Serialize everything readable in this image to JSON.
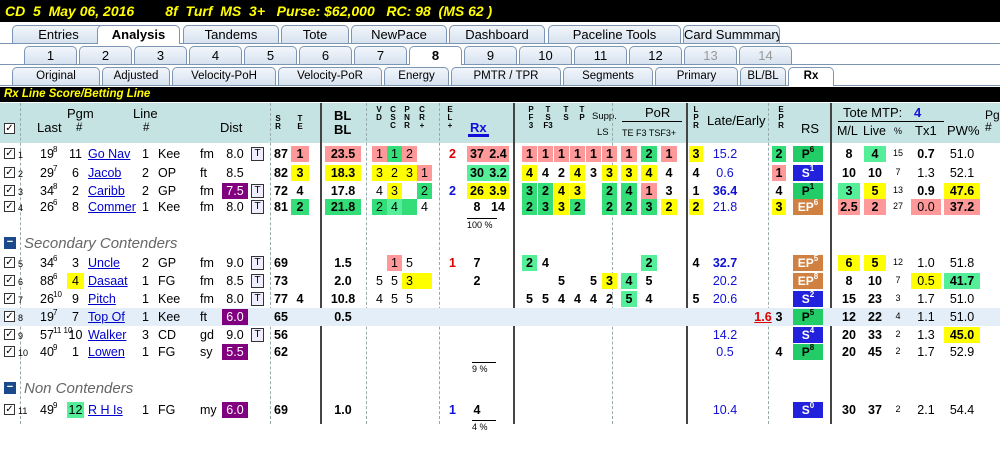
{
  "title": "CD  5  May 06, 2016        8f  Turf  MS  3+   Purse: $62,000   RC: 98  (MS 62 )",
  "tabs1": [
    "Entries",
    "Analysis",
    "Tandems",
    "Tote",
    "NewPace",
    "Dashboard",
    "Paceline Tools",
    "Card Summmary"
  ],
  "tabs2": [
    "1",
    "2",
    "3",
    "4",
    "5",
    "6",
    "7",
    "8",
    "9",
    "10",
    "11",
    "12",
    "13",
    "14"
  ],
  "tabs3": [
    "Original",
    "Adjusted",
    "Velocity-PoH",
    "Velocity-PoR",
    "Energy",
    "PMTR / TPR",
    "Segments",
    "Primary",
    "BL/BL",
    "Rx"
  ],
  "section": "Rx Line Score/Betting Line",
  "hdr": {
    "last": "Last",
    "pgm": "Pgm",
    "pgmh": "#",
    "line": "Line",
    "lineh": "#",
    "dist": "Dist",
    "sr": "S\nR",
    "te": "T\nE",
    "bl": "BL\nBL",
    "vdc": "V\nD",
    "csc": "C\nS\nC",
    "pnr": "P\nN\nR",
    "cr": "C\nR\n+",
    "el": "E\nL\n+",
    "rx": "Rx",
    "pf": "P\nF\n3",
    "tsf": "T\nS\nF3",
    "ts": "T\nS",
    "tp": "T\nP",
    "supp": "Supp.",
    "ls": "LS",
    "por": "PoR",
    "te2": "TE F3 TSF3+",
    "lpr": "L\nP\nR",
    "late": "Late/Early",
    "epr": "E\nP\nR",
    "rs": "RS",
    "tote": "Tote MTP:",
    "mtp": "4",
    "ml": "M/L",
    "live": "Live",
    "pctl": "%",
    "tx1": "Tx1",
    "pw": "PW%",
    "pg": "Pg\n#"
  },
  "group2": "Secondary Contenders",
  "group3": "Non Contenders",
  "pct1": "100 %",
  "pct2": "9 %",
  "pct3": "4 %",
  "rows": [
    {
      "n": "1",
      "last": "19",
      "lasts": "8",
      "pgm": "11",
      "name": "Go Nav",
      "line": "1",
      "trk": "Kee",
      "surf": "fm",
      "dist": "8.0",
      "t": "T",
      "sr": "87",
      "te": "1",
      "bl": "23.5",
      "v": "1",
      "c": "1",
      "p": "2",
      "cr": "",
      "el": "2",
      "rx1": "37",
      "rx2": "2.4",
      "pf": "1",
      "tsf": "1",
      "ts": "1",
      "tp": "1",
      "supp": "1",
      "ls": "1",
      "te3": "1",
      "f3": "2",
      "tsf3": "1",
      "lpr": "3",
      "late": "15.2",
      "epr": "2",
      "rs": "P",
      "rsn": "6",
      "ml": "8",
      "live": "4",
      "lp": "15",
      "tx1": "0.7",
      "pw": "51.0"
    },
    {
      "n": "2",
      "last": "29",
      "lasts": "7",
      "pgm": "6",
      "name": "Jacob",
      "line": "2",
      "trk": "OP",
      "surf": "ft",
      "dist": "8.5",
      "t": "",
      "sr": "82",
      "te": "3",
      "bl": "18.3",
      "v": "3",
      "c": "2",
      "p": "3",
      "cr": "1",
      "el": "",
      "rx1": "30",
      "rx2": "3.2",
      "pf": "4",
      "tsf": "4",
      "ts": "2",
      "tp": "4",
      "supp": "3",
      "ls": "3",
      "te3": "3",
      "f3": "4",
      "tsf3": "4",
      "lpr": "4",
      "late": "0.6",
      "epr": "1",
      "rs": "S",
      "rsn": "1",
      "ml": "10",
      "live": "10",
      "lp": "7",
      "tx1": "1.3",
      "pw": "52.1"
    },
    {
      "n": "3",
      "last": "34",
      "lasts": "8",
      "pgm": "2",
      "name": "Caribb",
      "line": "2",
      "trk": "GP",
      "surf": "fm",
      "dist": "7.5",
      "t": "T",
      "sr": "72",
      "te": "4",
      "bl": "17.8",
      "v": "4",
      "c": "3",
      "p": "",
      "cr": "2",
      "el": "2",
      "rx1": "26",
      "rx2": "3.9",
      "pf": "3",
      "tsf": "2",
      "ts": "4",
      "tp": "3",
      "supp": "",
      "ls": "2",
      "te3": "4",
      "f3": "1",
      "tsf3": "3",
      "lpr": "1",
      "late": "36.4",
      "epr": "4",
      "rs": "P",
      "rsn": "1",
      "ml": "3",
      "live": "5",
      "lp": "13",
      "tx1": "0.9",
      "pw": "47.6"
    },
    {
      "n": "4",
      "last": "26",
      "lasts": "6",
      "pgm": "8",
      "name": "Commer",
      "line": "1",
      "trk": "Kee",
      "surf": "fm",
      "dist": "8.0",
      "t": "T",
      "sr": "81",
      "te": "2",
      "bl": "21.8",
      "v": "2",
      "c": "4",
      "p": "",
      "cr": "4",
      "el": "",
      "rx1": "8",
      "rx2": "14",
      "pf": "2",
      "tsf": "3",
      "ts": "3",
      "tp": "2",
      "supp": "",
      "ls": "2",
      "te3": "2",
      "f3": "3",
      "tsf3": "2",
      "lpr": "2",
      "late": "21.8",
      "epr": "3",
      "rs": "EP",
      "rsn": "6",
      "ml": "2.5",
      "live": "2",
      "lp": "27",
      "tx1": "0.0",
      "pw": "37.2"
    },
    {
      "n": "5",
      "last": "34",
      "lasts": "6",
      "pgm": "3",
      "name": "Uncle",
      "line": "2",
      "trk": "GP",
      "surf": "fm",
      "dist": "9.0",
      "t": "T",
      "sr": "69",
      "te": "",
      "bl": "1.5",
      "v": "",
      "c": "1",
      "p": "5",
      "cr": "",
      "el": "1",
      "rx1": "7",
      "rx2": "",
      "pf": "2",
      "tsf": "4",
      "ts": "",
      "tp": "",
      "supp": "",
      "ls": "",
      "te3": "",
      "f3": "2",
      "tsf3": "",
      "lpr": "4",
      "late": "32.7",
      "epr": "",
      "rs": "EP",
      "rsn": "5",
      "ml": "6",
      "live": "5",
      "lp": "12",
      "tx1": "1.0",
      "pw": "51.8"
    },
    {
      "n": "6",
      "last": "88",
      "lasts": "6",
      "pgm": "4",
      "name": "Dasaat",
      "line": "1",
      "trk": "FG",
      "surf": "fm",
      "dist": "8.5",
      "t": "T",
      "sr": "73",
      "te": "",
      "bl": "2.0",
      "v": "5",
      "c": "5",
      "p": "3",
      "cr": "",
      "el": "",
      "rx1": "2",
      "rx2": "",
      "pf": "",
      "tsf": "",
      "ts": "5",
      "tp": "",
      "supp": "5",
      "ls": "3",
      "te3": "4",
      "f3": "5",
      "tsf3": "",
      "lpr": "",
      "late": "20.2",
      "epr": "",
      "rs": "EP",
      "rsn": "8",
      "ml": "8",
      "live": "10",
      "lp": "7",
      "tx1": "0.5",
      "pw": "41.7"
    },
    {
      "n": "7",
      "last": "26",
      "lasts": "10",
      "pgm": "9",
      "name": "Pitch",
      "line": "1",
      "trk": "Kee",
      "surf": "fm",
      "dist": "8.0",
      "t": "T",
      "sr": "77",
      "te": "4",
      "bl": "10.8",
      "v": "4",
      "c": "5",
      "p": "5",
      "cr": "",
      "el": "",
      "rx1": "",
      "rx2": "",
      "pf": "5",
      "tsf": "5",
      "ts": "4",
      "tp": "4",
      "supp": "4",
      "ls": "2",
      "te3": "5",
      "f3": "4",
      "tsf3": "",
      "lpr": "5",
      "late": "20.6",
      "epr": "",
      "rs": "S",
      "rsn": "2",
      "ml": "15",
      "live": "23",
      "lp": "3",
      "tx1": "1.7",
      "pw": "51.0"
    },
    {
      "n": "8",
      "last": "19",
      "lasts": "7",
      "pgm": "7",
      "name": "Top Of",
      "line": "1",
      "trk": "Kee",
      "surf": "ft",
      "dist": "6.0",
      "t": "",
      "sr": "65",
      "te": "",
      "bl": "0.5",
      "v": "",
      "c": "",
      "p": "",
      "cr": "",
      "el": "",
      "rx1": "",
      "rx2": "",
      "pf": "",
      "tsf": "",
      "ts": "",
      "tp": "",
      "supp": "",
      "ls": "",
      "te3": "",
      "f3": "",
      "tsf3": "",
      "lpr": "",
      "late": "1.6",
      "epr": "3",
      "rs": "P",
      "rsn": "5",
      "ml": "12",
      "live": "22",
      "lp": "4",
      "tx1": "1.1",
      "pw": "51.0"
    },
    {
      "n": "9",
      "last": "57",
      "lasts": "11 10",
      "pgm": "10",
      "name": "Walker",
      "line": "3",
      "trk": "CD",
      "surf": "gd",
      "dist": "9.0",
      "t": "T",
      "sr": "56",
      "te": "",
      "bl": "",
      "v": "",
      "c": "",
      "p": "",
      "cr": "",
      "el": "",
      "rx1": "",
      "rx2": "",
      "pf": "",
      "tsf": "",
      "ts": "",
      "tp": "",
      "supp": "",
      "ls": "",
      "te3": "",
      "f3": "",
      "tsf3": "",
      "lpr": "",
      "late": "14.2",
      "epr": "",
      "rs": "S",
      "rsn": "4",
      "ml": "20",
      "live": "33",
      "lp": "2",
      "tx1": "1.3",
      "pw": "45.0"
    },
    {
      "n": "10",
      "last": "40",
      "lasts": "9",
      "pgm": "1",
      "name": "Lowen",
      "line": "1",
      "trk": "FG",
      "surf": "sy",
      "dist": "5.5",
      "t": "",
      "sr": "62",
      "te": "",
      "bl": "",
      "v": "",
      "c": "",
      "p": "",
      "cr": "",
      "el": "",
      "rx1": "",
      "rx2": "",
      "pf": "",
      "tsf": "",
      "ts": "",
      "tp": "",
      "supp": "",
      "ls": "",
      "te3": "",
      "f3": "",
      "tsf3": "",
      "lpr": "",
      "late": "0.5",
      "epr": "4",
      "rs": "P",
      "rsn": "8",
      "ml": "20",
      "live": "45",
      "lp": "2",
      "tx1": "1.7",
      "pw": "52.9"
    },
    {
      "n": "11",
      "last": "49",
      "lasts": "9",
      "pgm": "12",
      "name": "R H Is",
      "line": "1",
      "trk": "FG",
      "surf": "my",
      "dist": "6.0",
      "t": "",
      "sr": "69",
      "te": "",
      "bl": "1.0",
      "v": "",
      "c": "",
      "p": "",
      "cr": "",
      "el": "1",
      "rx1": "4",
      "rx2": "",
      "pf": "",
      "tsf": "",
      "ts": "",
      "tp": "",
      "supp": "",
      "ls": "",
      "te3": "",
      "f3": "",
      "tsf3": "",
      "lpr": "",
      "late": "10.4",
      "epr": "",
      "rs": "S",
      "rsn": "0",
      "ml": "30",
      "live": "37",
      "lp": "2",
      "tx1": "2.1",
      "pw": "54.4"
    }
  ]
}
